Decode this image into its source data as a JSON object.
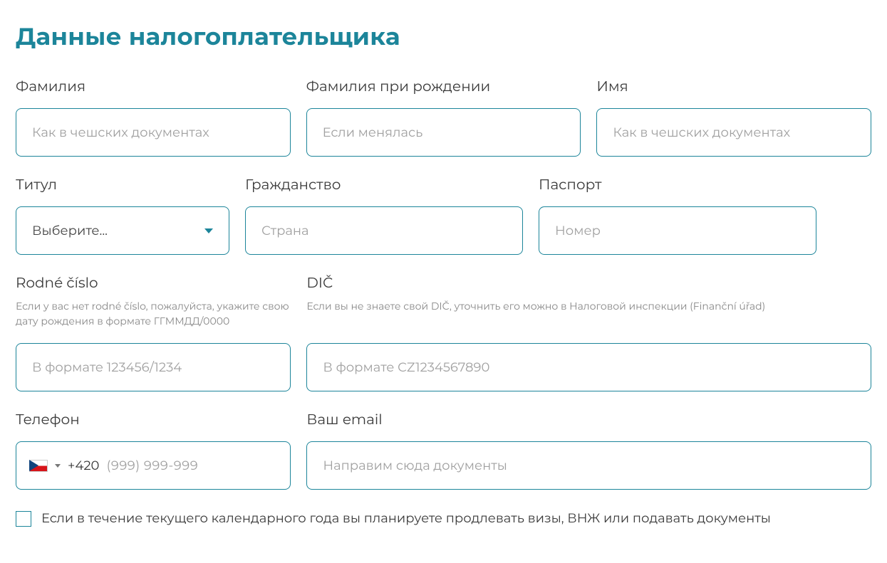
{
  "heading": "Данные налогоплательщика",
  "fields": {
    "surname": {
      "label": "Фамилия",
      "placeholder": "Как в чешских документах"
    },
    "birth_surname": {
      "label": "Фамилия при рождении",
      "placeholder": "Если менялась"
    },
    "first_name": {
      "label": "Имя",
      "placeholder": "Как в чешских документах"
    },
    "title": {
      "label": "Титул",
      "selected": "Выберите..."
    },
    "citizenship": {
      "label": "Гражданство",
      "placeholder": "Страна"
    },
    "passport": {
      "label": "Паспорт",
      "placeholder": "Номер"
    },
    "rodne_cislo": {
      "label": "Rodné číslo",
      "hint": "Если у вас нет rodné číslo, пожалуйста, укажите свою дату рождения в формате ГГММДД/0000",
      "placeholder": "В формате 123456/1234"
    },
    "dic": {
      "label": "DIČ",
      "hint": "Если вы не знаете свой DIČ, уточнить его можно в Налоговой инспекции (Finanční úřad)",
      "placeholder": "В формате CZ1234567890"
    },
    "phone": {
      "label": "Телефон",
      "prefix": "+420",
      "mask": "(999) 999-999"
    },
    "email": {
      "label": "Ваш email",
      "placeholder": "Направим сюда документы"
    }
  },
  "checkbox": {
    "label": "Если в течение текущего календарного года вы планируете продлевать визы, ВНЖ или подавать документы"
  }
}
